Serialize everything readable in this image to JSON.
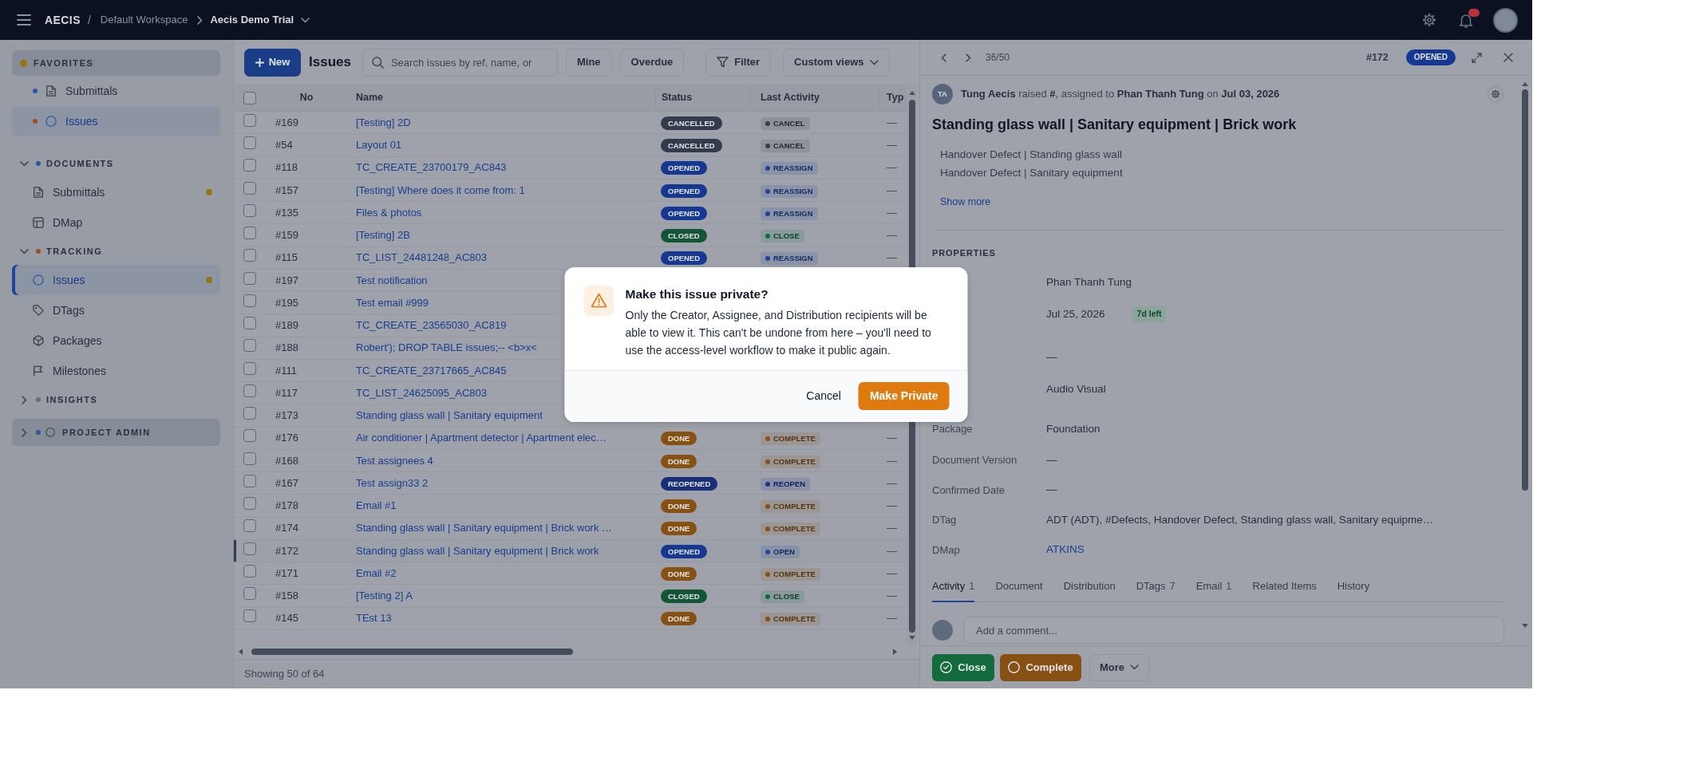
{
  "top_bar": {
    "brand": "AECIS",
    "separator": "/",
    "workspace": "Default Workspace",
    "project": "Aecis Demo Trial"
  },
  "sidebar": {
    "sections": [
      {
        "title": "FAVORITES",
        "kind": "favorites",
        "color": "#977714",
        "highlighted": true,
        "items": [
          {
            "label": "Submittals",
            "kind": "document",
            "color": "#2957a4",
            "selected": false,
            "has_updates": false
          },
          {
            "label": "Issues",
            "kind": "issue",
            "color": "#9b4e1e",
            "selected": true,
            "has_updates": false
          }
        ]
      },
      {
        "title": "DOCUMENTS",
        "kind": "group",
        "color": "#2957a4",
        "expanded": true,
        "highlighted": false,
        "items": [
          {
            "label": "Submittals",
            "kind": "document",
            "selected": false,
            "has_updates": true
          },
          {
            "label": "DMap",
            "kind": "map",
            "selected": false,
            "has_updates": false
          }
        ]
      },
      {
        "title": "TRACKING",
        "kind": "group",
        "color": "#9b4e1e",
        "expanded": true,
        "highlighted": false,
        "items": [
          {
            "label": "Issues",
            "kind": "issue",
            "selected": true,
            "has_updates": true
          },
          {
            "label": "DTags",
            "kind": "tag",
            "selected": false,
            "has_updates": false
          },
          {
            "label": "Packages",
            "kind": "package",
            "selected": false,
            "has_updates": false
          },
          {
            "label": "Milestones",
            "kind": "milestone",
            "selected": false,
            "has_updates": false
          }
        ]
      },
      {
        "title": "INSIGHTS",
        "kind": "group",
        "color": "#646b7a",
        "expanded": false,
        "highlighted": false
      },
      {
        "title": "PROJECT ADMIN",
        "kind": "admin",
        "color": "#2957a4",
        "expanded": false,
        "highlighted": true
      }
    ]
  },
  "list_panel": {
    "new_button": "New",
    "title": "Issues",
    "search_placeholder": "Search issues by ref, name, or",
    "quick_filters": [
      "Mine",
      "Overdue"
    ],
    "filter_button": "Filter",
    "views_button": "Custom views",
    "table": {
      "columns": [
        "No",
        "Name",
        "Status",
        "Last Activity",
        "Typ"
      ],
      "select_all_checked": false,
      "rows": [
        {
          "no": "#169",
          "name": "[Testing] 2D",
          "status": {
            "label": "CANCELLED",
            "color": "#333c4c"
          },
          "activity": {
            "label": "CANCEL",
            "color": "#333c4c"
          },
          "type": "—",
          "checked": false,
          "selected": false
        },
        {
          "no": "#54",
          "name": "Layout 01",
          "status": {
            "label": "CANCELLED",
            "color": "#333c4c"
          },
          "activity": {
            "label": "CANCEL",
            "color": "#333c4c"
          },
          "type": "—",
          "checked": false,
          "selected": false
        },
        {
          "no": "#118",
          "name": "TC_CREATE_23700179_AC843",
          "status": {
            "label": "OPENED",
            "color": "#173892"
          },
          "activity": {
            "label": "REASSIGN",
            "color": "#1c459e"
          },
          "type": "—",
          "checked": false,
          "selected": false
        },
        {
          "no": "#157",
          "name": "[Testing] Where does it come from: 1",
          "status": {
            "label": "OPENED",
            "color": "#173892"
          },
          "activity": {
            "label": "REASSIGN",
            "color": "#1c459e"
          },
          "type": "—",
          "checked": false,
          "selected": false
        },
        {
          "no": "#135",
          "name": "Files & photos",
          "status": {
            "label": "OPENED",
            "color": "#173892"
          },
          "activity": {
            "label": "REASSIGN",
            "color": "#1c459e"
          },
          "type": "—",
          "checked": false,
          "selected": false
        },
        {
          "no": "#159",
          "name": "[Testing] 2B",
          "status": {
            "label": "CLOSED",
            "color": "#135635"
          },
          "activity": {
            "label": "CLOSE",
            "color": "#136b3d"
          },
          "type": "—",
          "checked": false,
          "selected": false
        },
        {
          "no": "#115",
          "name": "TC_LIST_24481248_AC803",
          "status": {
            "label": "OPENED",
            "color": "#173892"
          },
          "activity": {
            "label": "REASSIGN",
            "color": "#1c459e"
          },
          "type": "—",
          "checked": false,
          "selected": false
        },
        {
          "no": "#197",
          "name": "Test notification",
          "checked": false,
          "selected": false
        },
        {
          "no": "#195",
          "name": "Test email #999",
          "checked": false,
          "selected": false
        },
        {
          "no": "#189",
          "name": "TC_CREATE_23565030_AC819",
          "checked": false,
          "selected": false
        },
        {
          "no": "#188",
          "name": "Robert'); DROP TABLE issues;-- <b>x<",
          "checked": false,
          "selected": false
        },
        {
          "no": "#111",
          "name": "TC_CREATE_23717665_AC845",
          "checked": false,
          "selected": false
        },
        {
          "no": "#117",
          "name": "TC_LIST_24625095_AC803",
          "checked": false,
          "selected": false
        },
        {
          "no": "#173",
          "name": "Standing glass wall | Sanitary equipment",
          "checked": false,
          "selected": false
        },
        {
          "no": "#176",
          "name": "Air conditioner | Apartment detector | Apartment elec…",
          "status": {
            "label": "DONE",
            "color": "#885114"
          },
          "activity": {
            "label": "COMPLETE",
            "color": "#885114"
          },
          "type": "—",
          "checked": false,
          "selected": false
        },
        {
          "no": "#168",
          "name": "Test assignees 4",
          "status": {
            "label": "DONE",
            "color": "#885114"
          },
          "activity": {
            "label": "COMPLETE",
            "color": "#885114"
          },
          "type": "—",
          "checked": false,
          "selected": false
        },
        {
          "no": "#167",
          "name": "Test assign33 2",
          "status": {
            "label": "REOPENED",
            "color": "#18307a"
          },
          "activity": {
            "label": "REOPEN",
            "color": "#173892"
          },
          "type": "—",
          "checked": false,
          "selected": false
        },
        {
          "no": "#178",
          "name": "Email #1",
          "status": {
            "label": "DONE",
            "color": "#885114"
          },
          "activity": {
            "label": "COMPLETE",
            "color": "#885114"
          },
          "type": "—",
          "checked": false,
          "selected": false
        },
        {
          "no": "#174",
          "name": "Standing glass wall | Sanitary equipment | Brick work …",
          "status": {
            "label": "DONE",
            "color": "#885114"
          },
          "activity": {
            "label": "COMPLETE",
            "color": "#885114"
          },
          "type": "—",
          "checked": false,
          "selected": false
        },
        {
          "no": "#172",
          "name": "Standing glass wall | Sanitary equipment | Brick work",
          "status": {
            "label": "OPENED",
            "color": "#173892"
          },
          "activity": {
            "label": "OPEN",
            "color": "#1c459e"
          },
          "type": "—",
          "checked": false,
          "selected": true
        },
        {
          "no": "#171",
          "name": "Email #2",
          "status": {
            "label": "DONE",
            "color": "#885114"
          },
          "activity": {
            "label": "COMPLETE",
            "color": "#885114"
          },
          "type": "—",
          "checked": false,
          "selected": false
        },
        {
          "no": "#158",
          "name": "[Testing 2] A",
          "status": {
            "label": "CLOSED",
            "color": "#135635"
          },
          "activity": {
            "label": "CLOSE",
            "color": "#136b3d"
          },
          "type": "—",
          "checked": false,
          "selected": false
        },
        {
          "no": "#145",
          "name": "TEst 13",
          "status": {
            "label": "DONE",
            "color": "#885114"
          },
          "activity": {
            "label": "COMPLETE",
            "color": "#885114"
          },
          "type": "—",
          "checked": false,
          "selected": false
        }
      ]
    },
    "footer": "Showing 50 of 64"
  },
  "detail": {
    "position": "36/50",
    "ref": "#172",
    "status": {
      "label": "OPENED",
      "color": "#173892"
    },
    "author_initials": "TA",
    "byline": "**Tung Aecis** raised **#**, assigned to **Phan Thanh Tung** on **Jul 03, 2026**",
    "title": "Standing glass wall | Sanitary equipment | Brick work",
    "description": [
      "Handover Defect | Standing glass wall",
      "Handover Defect | Sanitary equipment"
    ],
    "show_more": "Show more",
    "properties_title": "PROPERTIES",
    "properties": [
      {
        "value": "Phan Thanh Tung"
      },
      {
        "value": "Jul 25, 2026",
        "tag": "7d left"
      },
      {
        "value": "—"
      },
      {
        "value": "Audio Visual"
      },
      {
        "label": "Package",
        "value": "Foundation"
      },
      {
        "label": "Document Version",
        "value": "—"
      },
      {
        "label": "Confirmed Date",
        "value": "—"
      },
      {
        "label": "DTag",
        "value": "ADT (ADT), #Defects, Handover Defect, Standing glass wall, Sanitary equipme…"
      },
      {
        "label": "DMap",
        "value": "ATKINS",
        "kind": "link"
      }
    ],
    "tabs": [
      {
        "label": "Activity",
        "count": "1",
        "selected": true
      },
      {
        "label": "Document",
        "selected": false
      },
      {
        "label": "Distribution",
        "selected": false
      },
      {
        "label": "DTags",
        "count": "7",
        "selected": false
      },
      {
        "label": "Email",
        "count": "1",
        "selected": false
      },
      {
        "label": "Related Items",
        "selected": false
      },
      {
        "label": "History",
        "selected": false
      }
    ],
    "comment_placeholder": "Add a comment...",
    "actions": [
      {
        "label": "Close",
        "kind": "close"
      },
      {
        "label": "Complete",
        "kind": "complete"
      },
      {
        "label": "More",
        "kind": "menu"
      }
    ]
  },
  "dialog": {
    "title": "Make this issue private?",
    "message": "Only the Creator, Assignee, and Distribution recipients will be able to view it. This can't be undone from here – you'll need to use the access-level workflow to make it public again.",
    "cancel": "Cancel",
    "confirm": "Make Private"
  }
}
